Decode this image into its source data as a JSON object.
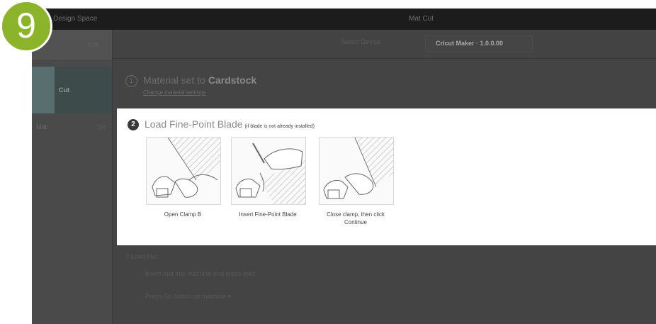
{
  "badge": {
    "number": "9"
  },
  "topbar": {
    "app_name": "Design Space",
    "window_title": "Mat Cut"
  },
  "sidebar": {
    "top_label": "Edit",
    "selected_item_label": "Cut",
    "row_left": "Mat",
    "row_right": "Go"
  },
  "toolbar": {
    "placeholder": "Select Device",
    "device_select": "Cricut Maker · 1.0.0.00"
  },
  "step1": {
    "number": "1",
    "title_prefix": "Material set to",
    "title_material": "Cardstock",
    "sub_link": "Change material settings"
  },
  "step2": {
    "number": "2",
    "title": "Load Fine-Point Blade",
    "note": "(if blade is not already installed)",
    "cards": [
      {
        "caption": "Open Clamp B"
      },
      {
        "caption": "Insert Fine-Point Blade"
      },
      {
        "caption": "Close clamp, then click Continue"
      }
    ]
  },
  "lower": {
    "step3": "3  Load Mat",
    "line1": "Insert mat into machine and press load",
    "line2": "Press Go button on machine  ▾"
  }
}
